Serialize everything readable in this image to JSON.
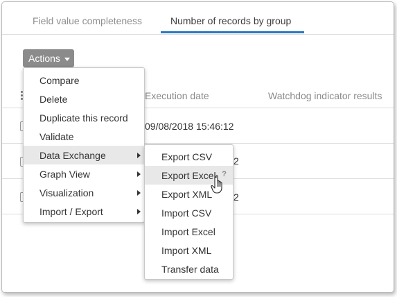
{
  "tabs": [
    {
      "label": "Field value completeness",
      "active": false
    },
    {
      "label": "Number of records by group",
      "active": true
    }
  ],
  "actions_button": {
    "label": "Actions"
  },
  "table": {
    "columns": [
      "Execution date",
      "Watchdog indicator results"
    ],
    "rows": [
      {
        "execution_date": "09/08/2018 15:46:12"
      },
      {
        "execution_date": "2"
      },
      {
        "execution_date": "2"
      }
    ]
  },
  "actions_menu": {
    "items": [
      {
        "label": "Compare"
      },
      {
        "label": "Delete"
      },
      {
        "label": "Duplicate this record"
      },
      {
        "label": "Validate"
      },
      {
        "label": "Data Exchange",
        "submenu": true,
        "highlighted": true
      },
      {
        "label": "Graph View",
        "submenu": true
      },
      {
        "label": "Visualization",
        "submenu": true
      },
      {
        "label": "Import / Export",
        "submenu": true
      }
    ]
  },
  "data_exchange_submenu": {
    "items": [
      {
        "label": "Export CSV"
      },
      {
        "label": "Export Excel",
        "highlighted": true,
        "help": "?"
      },
      {
        "label": "Export XML"
      },
      {
        "label": "Import CSV"
      },
      {
        "label": "Import Excel"
      },
      {
        "label": "Import XML"
      },
      {
        "label": "Transfer data"
      }
    ]
  },
  "colors": {
    "tab_underline": "#2b79c2",
    "button_bg": "#8b8b8b",
    "highlight": "#e8e8e8"
  }
}
